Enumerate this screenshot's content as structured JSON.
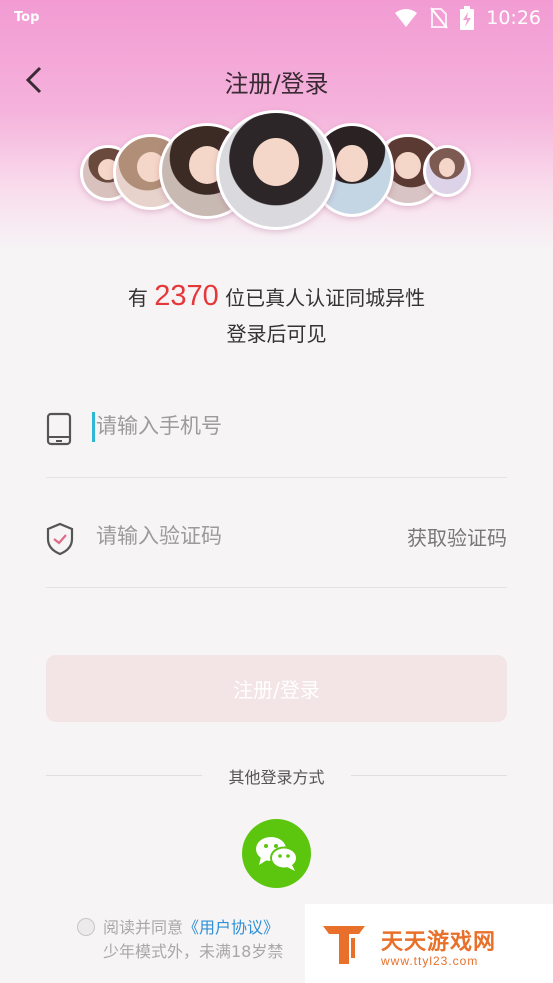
{
  "status_bar": {
    "carrier": "Top",
    "time": "10:26"
  },
  "nav": {
    "title": "注册/登录"
  },
  "promo": {
    "prefix": "有",
    "count": "2370",
    "suffix": "位已真人认证同城异性",
    "subline": "登录后可见"
  },
  "form": {
    "phone_placeholder": "请输入手机号",
    "code_placeholder": "请输入验证码",
    "get_code_label": "获取验证码",
    "submit_label": "注册/登录"
  },
  "other_login": {
    "label": "其他登录方式",
    "method_icon": "wechat-icon"
  },
  "agreement": {
    "line1_prefix": "阅读并同意",
    "link": "《用户协议》",
    "line2": "少年模式外，未满18岁禁"
  },
  "watermark": {
    "title": "天天游戏网",
    "url": "www.ttyl23.com"
  },
  "colors": {
    "accent_red": "#e5383b",
    "caret": "#30b7d4",
    "wechat_green": "#5cc60e",
    "link_blue": "#2f8fd6",
    "watermark_orange": "#e9702a"
  }
}
